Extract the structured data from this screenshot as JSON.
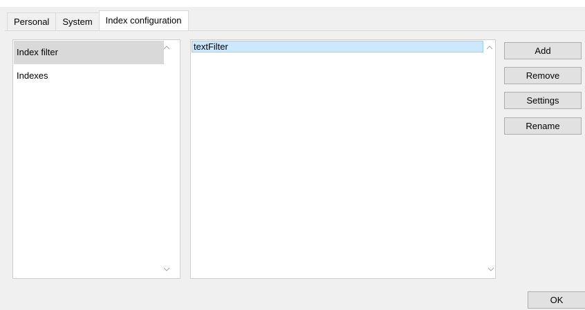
{
  "tabs": [
    {
      "label": "Personal",
      "active": false
    },
    {
      "label": "System",
      "active": false
    },
    {
      "label": "Index configuration",
      "active": true
    }
  ],
  "left_list": {
    "items": [
      {
        "label": "Index filter",
        "selected": true
      },
      {
        "label": "Indexes",
        "selected": false
      }
    ]
  },
  "right_list": {
    "items": [
      {
        "label": "textFilter",
        "selected": true
      }
    ]
  },
  "buttons": {
    "add": "Add",
    "remove": "Remove",
    "settings": "Settings",
    "rename": "Rename",
    "ok": "OK"
  },
  "colors": {
    "selection_highlight": "#cce8ff",
    "selection_border": "#99d1ff",
    "left_selection": "#d9d9d9",
    "dialog_bg": "#f0f0f0"
  }
}
